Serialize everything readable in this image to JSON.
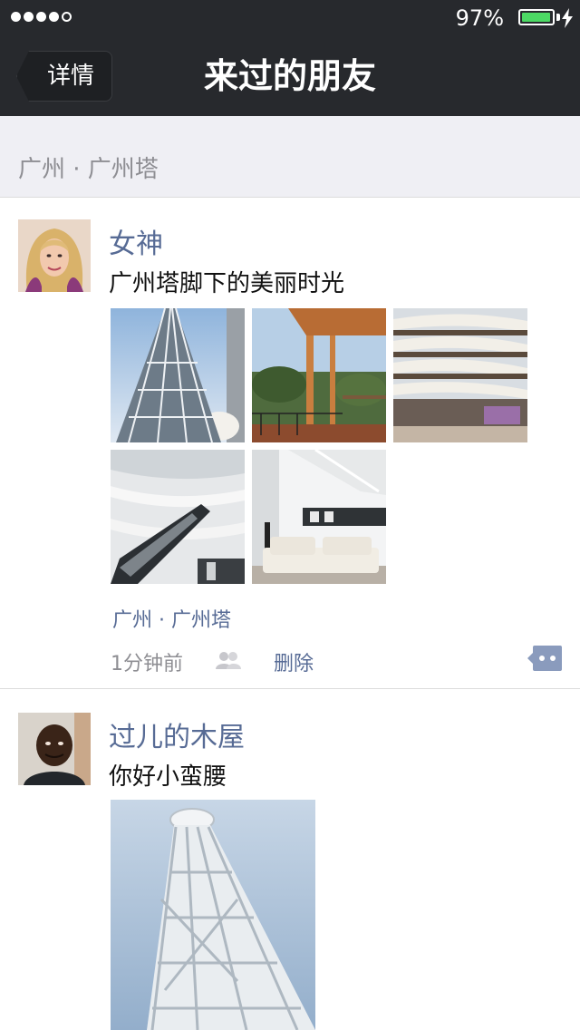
{
  "status": {
    "signal_dots": 5,
    "signal_filled": 4,
    "battery_percent_text": "97%",
    "battery_level": 0.97
  },
  "nav": {
    "back_label": "详情",
    "title": "来过的朋友"
  },
  "location_header": {
    "text": "广州 · 广州塔"
  },
  "posts": [
    {
      "name": "女神",
      "text": "广州塔脚下的美丽时光",
      "location": "广州 · 广州塔",
      "time": "1分钟前",
      "delete_label": "删除"
    },
    {
      "name": "过儿的木屋",
      "text": "你好小蛮腰"
    }
  ],
  "colors": {
    "navbar": "#27292d",
    "link": "#576b95",
    "battery_green": "#4cd964"
  },
  "icons": [
    "friends-icon",
    "comment-icon",
    "back-arrow-icon",
    "charging-bolt-icon"
  ]
}
